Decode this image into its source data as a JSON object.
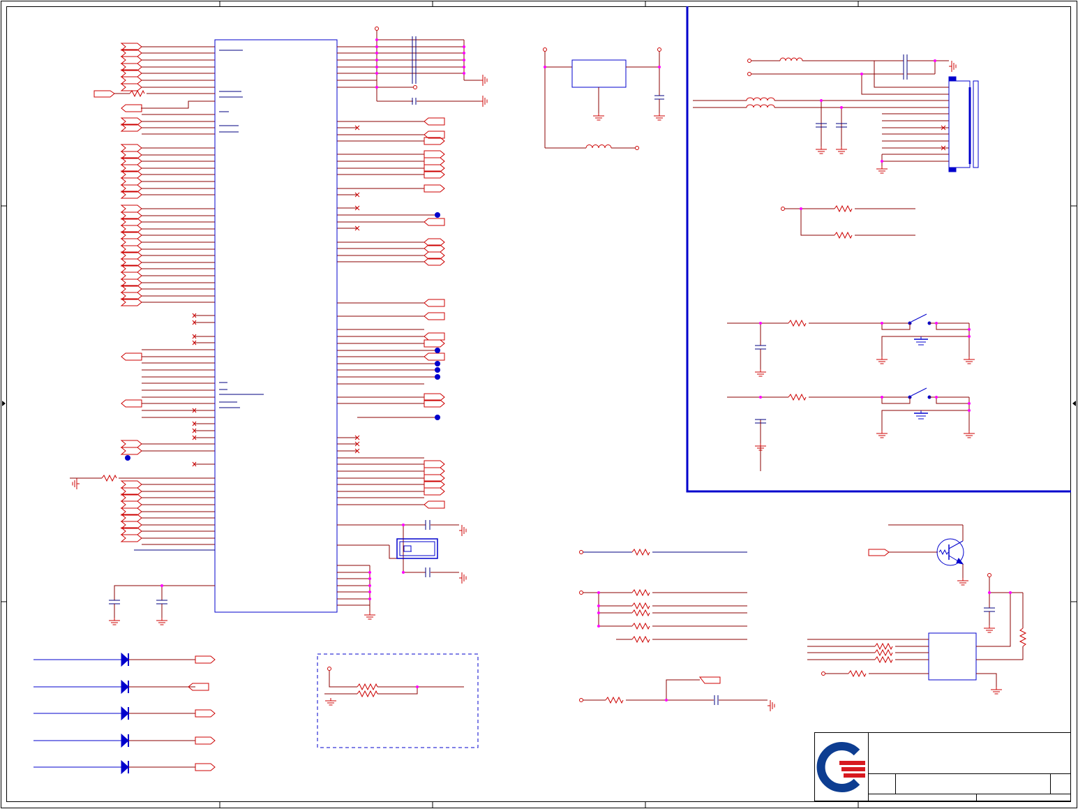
{
  "colors": {
    "frame": "#000000",
    "wire": "#8b0000",
    "signal": "#000080",
    "component": "#cc0000",
    "body": "#0000cc",
    "junction": "#ff00ff",
    "logo_blue": "#0d3d91",
    "logo_red": "#d7191f"
  },
  "icons": {
    "logo": "company-logo-icon",
    "ground": "ground-icon",
    "diode": "diode-icon",
    "resistor": "resistor-icon",
    "inductor": "inductor-icon",
    "capacitor": "capacitor-icon",
    "transistor": "npn-transistor-icon",
    "switch": "push-switch-icon",
    "crystal": "crystal-icon",
    "connector": "connector-icon"
  }
}
